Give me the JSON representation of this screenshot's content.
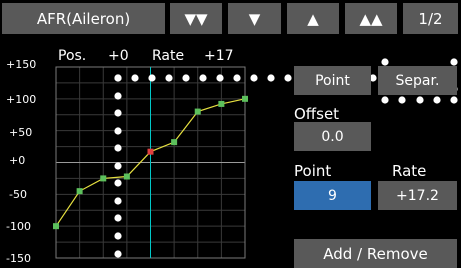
{
  "header": {
    "title": "AFR(Aileron)",
    "btn_down_fast": "▼▼",
    "btn_down": "▼",
    "btn_up": "▲",
    "btn_up_fast": "▲▲",
    "page": "1/2"
  },
  "graph": {
    "pos_label": "Pos.",
    "pos_value": "+0",
    "rate_label": "Rate",
    "rate_value": "+17",
    "y_ticks": [
      "+150",
      "+100",
      "+50",
      "+0",
      "-50",
      "-100",
      "-150"
    ]
  },
  "chart_data": {
    "type": "line",
    "x": [
      -100,
      -75,
      -50,
      -25,
      0,
      25,
      50,
      75,
      100
    ],
    "values": [
      -100,
      -45,
      -25,
      -22,
      17,
      32,
      80,
      92,
      100
    ],
    "ylim": [
      -150,
      150
    ],
    "xlim": [
      -100,
      100
    ],
    "grid": true,
    "selected_index": 4
  },
  "controls": {
    "point_btn": "Point",
    "separ_btn": "Separ.",
    "offset_label": "Offset",
    "offset_value": "0.0",
    "point_label": "Point",
    "point_value": "9",
    "rate_label": "Rate",
    "rate_value": "+17.2",
    "add_remove": "Add / Remove"
  },
  "colors": {
    "background": "#000000",
    "button": "#595959",
    "selected": "#2e6db0",
    "curve": "#e6e040",
    "point": "#5cc05c",
    "current_point": "#e04040",
    "cursor": "#00c8c8",
    "grid": "#3a3a3a"
  }
}
